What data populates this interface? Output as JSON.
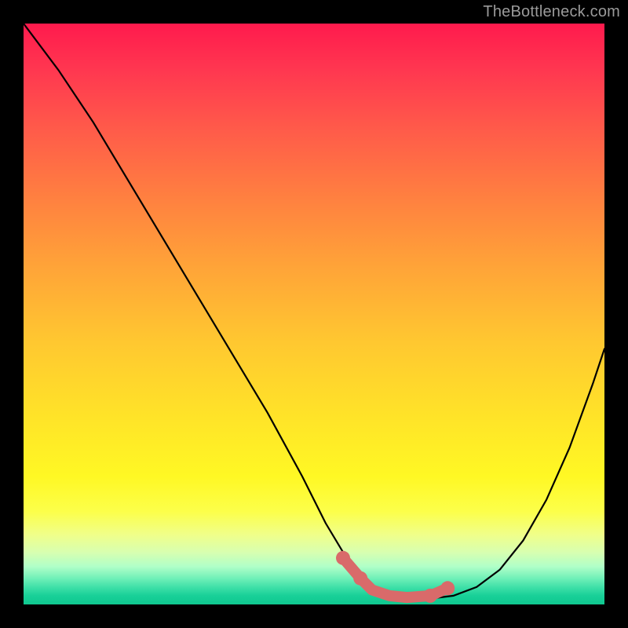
{
  "watermark": "TheBottleneck.com",
  "chart_data": {
    "type": "line",
    "title": "",
    "xlabel": "",
    "ylabel": "",
    "xlim": [
      0,
      100
    ],
    "ylim": [
      0,
      100
    ],
    "series": [
      {
        "name": "curve",
        "color": "#000000",
        "x": [
          0,
          6,
          12,
          18,
          24,
          30,
          36,
          42,
          48,
          52,
          55,
          58,
          60,
          63,
          66,
          70,
          74,
          78,
          82,
          86,
          90,
          94,
          98,
          100
        ],
        "y": [
          100,
          92,
          83,
          73,
          63,
          53,
          43,
          33,
          22,
          14,
          9,
          5,
          3,
          1.5,
          1,
          1,
          1.5,
          3,
          6,
          11,
          18,
          27,
          38,
          44
        ]
      }
    ],
    "highlight": {
      "name": "bottom-highlight",
      "color": "#d96a6a",
      "x": [
        55,
        58,
        60,
        63,
        66,
        70,
        73
      ],
      "y": [
        8,
        4.5,
        2.5,
        1.5,
        1.2,
        1.5,
        2.8
      ]
    }
  }
}
